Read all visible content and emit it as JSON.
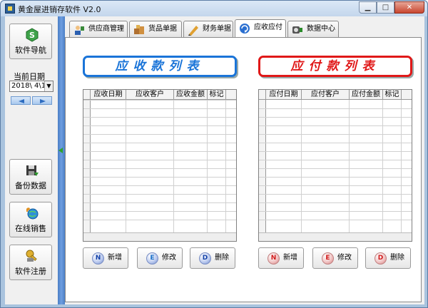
{
  "window": {
    "title": "黄金屋进销存软件 V2.0",
    "min_glyph": "▁",
    "max_glyph": "□",
    "close_glyph": "✕"
  },
  "leftnav": {
    "nav_label": "软件导航",
    "date_label": "当前日期",
    "date_value": "2018\\ 4\\1(",
    "backup_label": "备份数据",
    "online_sales_label": "在线销售",
    "register_label": "软件注册"
  },
  "tabs": [
    {
      "label": "供应商管理",
      "icon": "supplier-icon"
    },
    {
      "label": "货品单据",
      "icon": "goods-doc-icon"
    },
    {
      "label": "财务单据",
      "icon": "finance-doc-icon"
    },
    {
      "label": "应收应付",
      "icon": "receivable-icon",
      "active": true
    },
    {
      "label": "数据中心",
      "icon": "data-center-icon"
    }
  ],
  "receivable": {
    "banner": "应收款列表",
    "color": "#1a74d8",
    "columns": [
      "应收日期",
      "应收客户",
      "应收金额",
      "标记"
    ],
    "rows": [],
    "add_key": "N",
    "add_label": "新增",
    "edit_key": "E",
    "edit_label": "修改",
    "delete_key": "D",
    "delete_label": "删除"
  },
  "payable": {
    "banner": "应付款列表",
    "color": "#e01818",
    "columns": [
      "应付日期",
      "应付客户",
      "应付金额",
      "标记"
    ],
    "rows": [],
    "add_key": "N",
    "add_label": "新增",
    "edit_key": "E",
    "edit_label": "修改",
    "delete_key": "D",
    "delete_label": "删除"
  }
}
